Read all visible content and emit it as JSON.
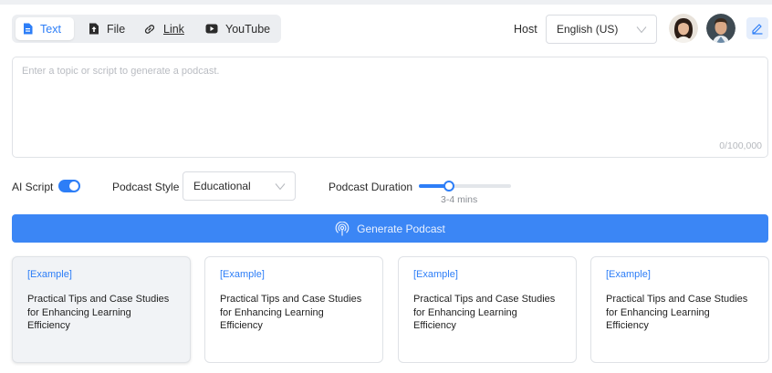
{
  "tabs": [
    {
      "label": "Text",
      "icon": "document-icon",
      "active": true
    },
    {
      "label": "File",
      "icon": "upload-file-icon",
      "active": false
    },
    {
      "label": "Link",
      "icon": "link-icon",
      "active": false
    },
    {
      "label": "YouTube",
      "icon": "youtube-icon",
      "active": false
    }
  ],
  "host": {
    "label": "Host",
    "language": "English (US)",
    "avatars": [
      "female-host-avatar",
      "male-host-avatar"
    ],
    "edit_icon": "pencil-icon"
  },
  "topic": {
    "placeholder": "Enter a topic or script to generate a podcast.",
    "value": "",
    "counter": "0/100,000"
  },
  "options": {
    "ai_script_label": "AI Script",
    "ai_script_on": true,
    "style_label": "Podcast Style",
    "style_value": "Educational",
    "duration_label": "Podcast Duration",
    "duration_value": "3-4 mins",
    "duration_level": 0.33
  },
  "generate": {
    "label": "Generate Podcast",
    "icon": "broadcast-icon"
  },
  "examples": [
    {
      "tag": "[Example]",
      "title": "Practical Tips and Case Studies for Enhancing Learning Efficiency"
    },
    {
      "tag": "[Example]",
      "title": "Practical Tips and Case Studies for Enhancing Learning Efficiency"
    },
    {
      "tag": "[Example]",
      "title": "Practical Tips and Case Studies for Enhancing Learning Efficiency"
    },
    {
      "tag": "[Example]",
      "title": "Practical Tips and Case Studies for Enhancing Learning Efficiency"
    }
  ],
  "colors": {
    "accent": "#2d7ef7",
    "button": "#3b86f5",
    "border": "#dfe2e6"
  }
}
